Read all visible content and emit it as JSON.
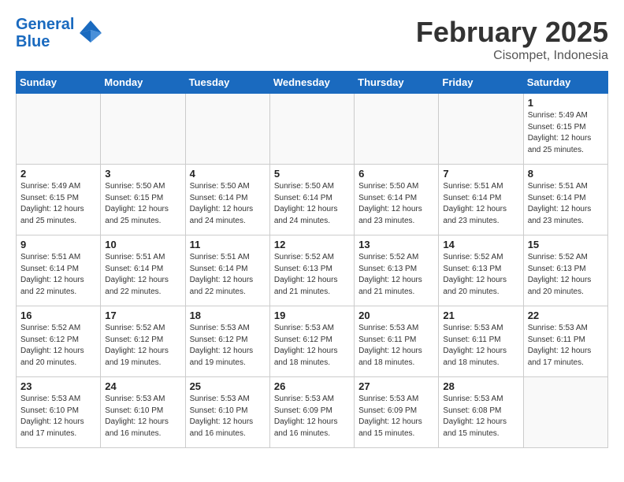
{
  "header": {
    "logo_line1": "General",
    "logo_line2": "Blue",
    "month_title": "February 2025",
    "subtitle": "Cisompet, Indonesia"
  },
  "days_of_week": [
    "Sunday",
    "Monday",
    "Tuesday",
    "Wednesday",
    "Thursday",
    "Friday",
    "Saturday"
  ],
  "weeks": [
    [
      {
        "day": "",
        "info": ""
      },
      {
        "day": "",
        "info": ""
      },
      {
        "day": "",
        "info": ""
      },
      {
        "day": "",
        "info": ""
      },
      {
        "day": "",
        "info": ""
      },
      {
        "day": "",
        "info": ""
      },
      {
        "day": "1",
        "info": "Sunrise: 5:49 AM\nSunset: 6:15 PM\nDaylight: 12 hours\nand 25 minutes."
      }
    ],
    [
      {
        "day": "2",
        "info": "Sunrise: 5:49 AM\nSunset: 6:15 PM\nDaylight: 12 hours\nand 25 minutes."
      },
      {
        "day": "3",
        "info": "Sunrise: 5:50 AM\nSunset: 6:15 PM\nDaylight: 12 hours\nand 25 minutes."
      },
      {
        "day": "4",
        "info": "Sunrise: 5:50 AM\nSunset: 6:14 PM\nDaylight: 12 hours\nand 24 minutes."
      },
      {
        "day": "5",
        "info": "Sunrise: 5:50 AM\nSunset: 6:14 PM\nDaylight: 12 hours\nand 24 minutes."
      },
      {
        "day": "6",
        "info": "Sunrise: 5:50 AM\nSunset: 6:14 PM\nDaylight: 12 hours\nand 23 minutes."
      },
      {
        "day": "7",
        "info": "Sunrise: 5:51 AM\nSunset: 6:14 PM\nDaylight: 12 hours\nand 23 minutes."
      },
      {
        "day": "8",
        "info": "Sunrise: 5:51 AM\nSunset: 6:14 PM\nDaylight: 12 hours\nand 23 minutes."
      }
    ],
    [
      {
        "day": "9",
        "info": "Sunrise: 5:51 AM\nSunset: 6:14 PM\nDaylight: 12 hours\nand 22 minutes."
      },
      {
        "day": "10",
        "info": "Sunrise: 5:51 AM\nSunset: 6:14 PM\nDaylight: 12 hours\nand 22 minutes."
      },
      {
        "day": "11",
        "info": "Sunrise: 5:51 AM\nSunset: 6:14 PM\nDaylight: 12 hours\nand 22 minutes."
      },
      {
        "day": "12",
        "info": "Sunrise: 5:52 AM\nSunset: 6:13 PM\nDaylight: 12 hours\nand 21 minutes."
      },
      {
        "day": "13",
        "info": "Sunrise: 5:52 AM\nSunset: 6:13 PM\nDaylight: 12 hours\nand 21 minutes."
      },
      {
        "day": "14",
        "info": "Sunrise: 5:52 AM\nSunset: 6:13 PM\nDaylight: 12 hours\nand 20 minutes."
      },
      {
        "day": "15",
        "info": "Sunrise: 5:52 AM\nSunset: 6:13 PM\nDaylight: 12 hours\nand 20 minutes."
      }
    ],
    [
      {
        "day": "16",
        "info": "Sunrise: 5:52 AM\nSunset: 6:12 PM\nDaylight: 12 hours\nand 20 minutes."
      },
      {
        "day": "17",
        "info": "Sunrise: 5:52 AM\nSunset: 6:12 PM\nDaylight: 12 hours\nand 19 minutes."
      },
      {
        "day": "18",
        "info": "Sunrise: 5:53 AM\nSunset: 6:12 PM\nDaylight: 12 hours\nand 19 minutes."
      },
      {
        "day": "19",
        "info": "Sunrise: 5:53 AM\nSunset: 6:12 PM\nDaylight: 12 hours\nand 18 minutes."
      },
      {
        "day": "20",
        "info": "Sunrise: 5:53 AM\nSunset: 6:11 PM\nDaylight: 12 hours\nand 18 minutes."
      },
      {
        "day": "21",
        "info": "Sunrise: 5:53 AM\nSunset: 6:11 PM\nDaylight: 12 hours\nand 18 minutes."
      },
      {
        "day": "22",
        "info": "Sunrise: 5:53 AM\nSunset: 6:11 PM\nDaylight: 12 hours\nand 17 minutes."
      }
    ],
    [
      {
        "day": "23",
        "info": "Sunrise: 5:53 AM\nSunset: 6:10 PM\nDaylight: 12 hours\nand 17 minutes."
      },
      {
        "day": "24",
        "info": "Sunrise: 5:53 AM\nSunset: 6:10 PM\nDaylight: 12 hours\nand 16 minutes."
      },
      {
        "day": "25",
        "info": "Sunrise: 5:53 AM\nSunset: 6:10 PM\nDaylight: 12 hours\nand 16 minutes."
      },
      {
        "day": "26",
        "info": "Sunrise: 5:53 AM\nSunset: 6:09 PM\nDaylight: 12 hours\nand 16 minutes."
      },
      {
        "day": "27",
        "info": "Sunrise: 5:53 AM\nSunset: 6:09 PM\nDaylight: 12 hours\nand 15 minutes."
      },
      {
        "day": "28",
        "info": "Sunrise: 5:53 AM\nSunset: 6:08 PM\nDaylight: 12 hours\nand 15 minutes."
      },
      {
        "day": "",
        "info": ""
      }
    ]
  ]
}
